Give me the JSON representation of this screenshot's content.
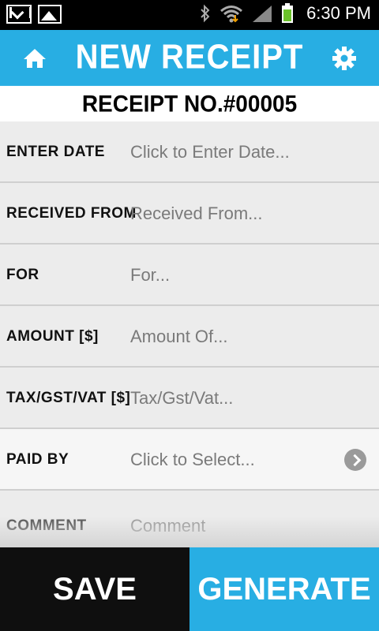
{
  "status_bar": {
    "time": "6:30 PM",
    "icons": [
      "gmail-icon",
      "gallery-icon",
      "bluetooth-icon",
      "wifi-icon",
      "signal-icon",
      "battery-icon"
    ]
  },
  "header": {
    "title": "NEW RECEIPT",
    "home_icon": "home-icon",
    "settings_icon": "gear-icon",
    "color": "#28aee3"
  },
  "receipt": {
    "number_text": "RECEIPT NO.#00005"
  },
  "form": {
    "rows": [
      {
        "label": "ENTER DATE",
        "placeholder": "Click to Enter Date..."
      },
      {
        "label": "RECEIVED FROM",
        "placeholder": "Received From..."
      },
      {
        "label": "FOR",
        "placeholder": "For..."
      },
      {
        "label": "AMOUNT [$]",
        "placeholder": "Amount Of..."
      },
      {
        "label": "TAX/GST/VAT [$]",
        "placeholder": "Tax/Gst/Vat..."
      },
      {
        "label": "PAID BY",
        "placeholder": "Click to Select..."
      },
      {
        "label": "COMMENT",
        "placeholder": "Comment"
      }
    ]
  },
  "buttons": {
    "save": "SAVE",
    "generate": "GENERATE"
  },
  "colors": {
    "accent": "#28aee3",
    "save_bg": "#0f0f0f"
  }
}
